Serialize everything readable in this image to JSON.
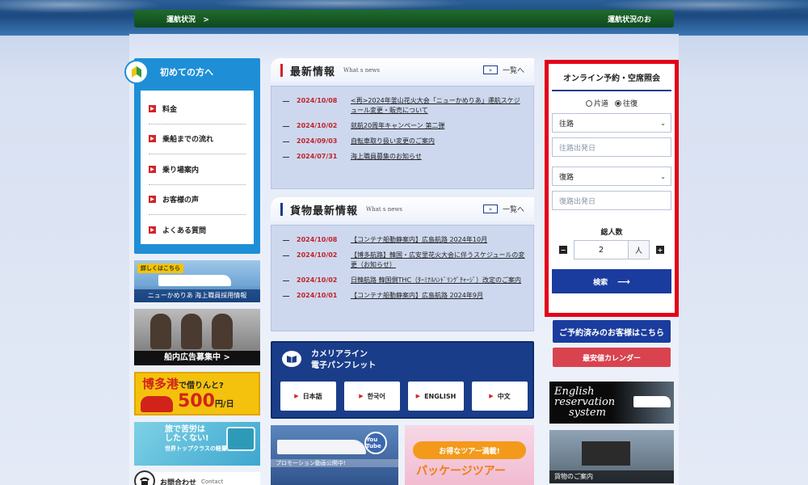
{
  "topbar": {
    "left_label": "運航状況",
    "right_label": "運航状況のお"
  },
  "sidebar": {
    "heading": "初めての方へ",
    "items": [
      {
        "label": "料金"
      },
      {
        "label": "乗船までの流れ"
      },
      {
        "label": "乗り場案内"
      },
      {
        "label": "お客様の声"
      },
      {
        "label": "よくある質問"
      }
    ]
  },
  "left_banners": {
    "recruit_tag": "詳しくはこちら",
    "recruit_text": "ニューかめりあ 海上職員採用情報",
    "ad_text": "船内広告募集中 >",
    "hakata_line1": "博多港",
    "hakata_line1_small": "で借りんと?",
    "hakata_price": "500",
    "hakata_unit": "円/日",
    "travel_line1": "旅で苦労は",
    "travel_line1b": "したくない!",
    "travel_line2": "世界トップクラスの軽量キャリー",
    "contact_label": "お問合わせ",
    "contact_en": "Contact"
  },
  "news": {
    "title": "最新情報",
    "en_title": "What s news",
    "more": "一覧へ",
    "items": [
      {
        "date": "2024/10/08",
        "text": "<再>2024年釜山花火大会「ニューかめりあ」運航スケジュール変更・販売について"
      },
      {
        "date": "2024/10/02",
        "text": "就航20周年キャンペーン 第二弾"
      },
      {
        "date": "2024/09/03",
        "text": "自転車取り扱い変更のご案内"
      },
      {
        "date": "2024/07/31",
        "text": "海上職員募集のお知らせ"
      }
    ]
  },
  "cargo_news": {
    "title": "貨物最新情報",
    "en_title": "What s news",
    "more": "一覧へ",
    "items": [
      {
        "date": "2024/10/08",
        "text": "【コンテナ船動静案内】広島航路 2024年10月"
      },
      {
        "date": "2024/10/02",
        "text": "【博多航路】韓国・広安里花火大会に伴うスケジュールの変更（お知らせ）"
      },
      {
        "date": "2024/10/02",
        "text": "日韓航路 韓国側THC（ﾀｰﾐﾅﾙﾊﾝﾄﾞﾘﾝｸﾞﾁｬｰｼﾞ）改定のご案内"
      },
      {
        "date": "2024/10/01",
        "text": "【コンテナ船動静案内】広島航路 2024年9月"
      }
    ]
  },
  "pamphlet": {
    "title_line1": "カメリアライン",
    "title_line2": "電子パンフレット",
    "languages": [
      "日本語",
      "한국어",
      "ENGLISH",
      "中文"
    ]
  },
  "mid_banners": {
    "promo_caption": "プロモーション動画公開中!",
    "youtube": "You Tube",
    "tour_pill": "お得なツアー満載!",
    "tour_big": "パッケージツアー"
  },
  "reservation": {
    "title": "オンライン予約・空席照会",
    "trip_options": [
      {
        "label": "片道",
        "selected": false
      },
      {
        "label": "往復",
        "selected": true
      }
    ],
    "outbound_route": "往路",
    "outbound_date_placeholder": "往路出発日",
    "return_route": "復路",
    "return_date_placeholder": "復路出発日",
    "pax_label": "総人数",
    "pax_value": "2",
    "pax_unit": "人",
    "search_label": "検索",
    "booked_label": "ご予約済みのお客様はこちら",
    "calendar_label": "最安値カレンダー"
  },
  "right_banners": {
    "english_line1": "English",
    "english_line2": "reservation",
    "english_line3": "system",
    "cargo_caption": "貨物のご案内"
  }
}
